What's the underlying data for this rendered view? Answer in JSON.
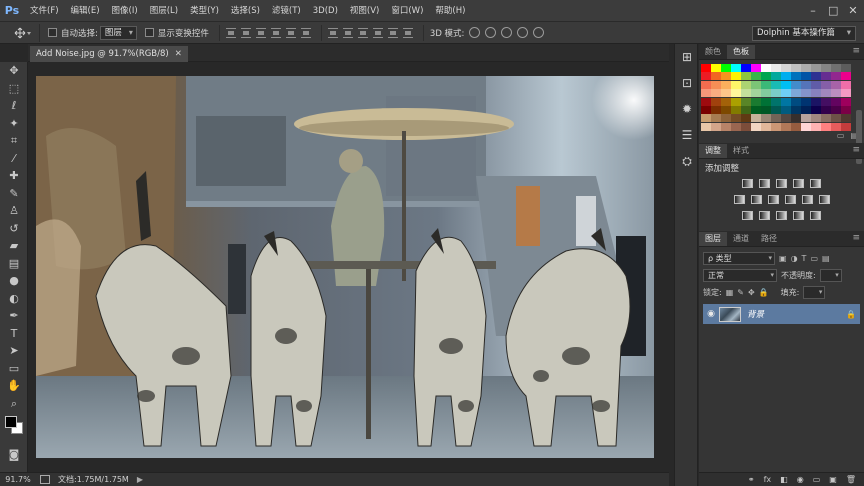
{
  "app": {
    "logo": "Ps"
  },
  "menu": [
    {
      "id": "file",
      "label": "文件(F)"
    },
    {
      "id": "edit",
      "label": "编辑(E)"
    },
    {
      "id": "image",
      "label": "图像(I)"
    },
    {
      "id": "layer",
      "label": "图层(L)"
    },
    {
      "id": "type",
      "label": "类型(Y)"
    },
    {
      "id": "select",
      "label": "选择(S)"
    },
    {
      "id": "filter",
      "label": "滤镜(T)"
    },
    {
      "id": "3d",
      "label": "3D(D)"
    },
    {
      "id": "view",
      "label": "视图(V)"
    },
    {
      "id": "window",
      "label": "窗口(W)"
    },
    {
      "id": "help",
      "label": "帮助(H)"
    }
  ],
  "window_controls": {
    "minimize": "–",
    "maximize": "□",
    "close": "✕"
  },
  "options": {
    "auto_select_label": "自动选择:",
    "auto_select_value": "图层",
    "show_transform_label": "显示变换控件",
    "mode_3d_label": "3D 模式:",
    "workspace": "Dolphin 基本操作篇"
  },
  "document": {
    "tab_title": "Add Noise.jpg @ 91.7%(RGB/8)",
    "close_glyph": "✕"
  },
  "status": {
    "zoom": "91.7%",
    "doc_info": "文档:1.75M/1.75M",
    "arrow": "▶"
  },
  "tools": [
    {
      "name": "move-tool-icon",
      "glyph": "✥"
    },
    {
      "name": "marquee-tool-icon",
      "glyph": "⬚"
    },
    {
      "name": "lasso-tool-icon",
      "glyph": "ℓ"
    },
    {
      "name": "magic-wand-icon",
      "glyph": "✦"
    },
    {
      "name": "crop-tool-icon",
      "glyph": "⌗"
    },
    {
      "name": "eyedropper-icon",
      "glyph": "⁄"
    },
    {
      "name": "healing-brush-icon",
      "glyph": "✚"
    },
    {
      "name": "brush-tool-icon",
      "glyph": "✎"
    },
    {
      "name": "clone-stamp-icon",
      "glyph": "♙"
    },
    {
      "name": "history-brush-icon",
      "glyph": "↺"
    },
    {
      "name": "eraser-tool-icon",
      "glyph": "▰"
    },
    {
      "name": "gradient-tool-icon",
      "glyph": "▤"
    },
    {
      "name": "blur-tool-icon",
      "glyph": "●"
    },
    {
      "name": "dodge-tool-icon",
      "glyph": "◐"
    },
    {
      "name": "pen-tool-icon",
      "glyph": "✒"
    },
    {
      "name": "type-tool-icon",
      "glyph": "T"
    },
    {
      "name": "path-select-icon",
      "glyph": "➤"
    },
    {
      "name": "shape-tool-icon",
      "glyph": "▭"
    },
    {
      "name": "hand-tool-icon",
      "glyph": "✋"
    },
    {
      "name": "zoom-tool-icon",
      "glyph": "⌕"
    }
  ],
  "panels": {
    "color_tabs": {
      "color": "颜色",
      "swatches": "色板"
    },
    "adjust_tabs": {
      "adjustments": "调整",
      "styles": "样式"
    },
    "adjust_title": "添加调整",
    "layer_tabs": {
      "layers": "图层",
      "channels": "通道",
      "paths": "路径"
    },
    "layer_kind": "ρ 类型",
    "blend_mode": "正常",
    "opacity_label": "不透明度:",
    "lock_label": "锁定:",
    "fill_label": "填充:",
    "layer_name": "背景",
    "footer_icons": [
      "⚭",
      "fx",
      "◧",
      "◉",
      "▭",
      "▣",
      "🗑"
    ]
  },
  "swatch_colors": [
    [
      "#ff0000",
      "#ffff00",
      "#00ff00",
      "#00ffff",
      "#0000ff",
      "#ff00ff",
      "#ffffff",
      "#ebebeb",
      "#d6d6d6",
      "#c2c2c2",
      "#adadad",
      "#999999",
      "#858585",
      "#707070",
      "#5c5c5c"
    ],
    [
      "#ed1c24",
      "#f26522",
      "#f7941d",
      "#fff200",
      "#8dc63f",
      "#39b54a",
      "#00a651",
      "#00a99d",
      "#00aeef",
      "#0072bc",
      "#0054a6",
      "#2e3192",
      "#662d91",
      "#92278f",
      "#ec008c"
    ],
    [
      "#f26c4f",
      "#f68e56",
      "#fbaf5d",
      "#fff568",
      "#acd372",
      "#7cc576",
      "#3bb878",
      "#1abbb4",
      "#00bff3",
      "#438ccb",
      "#5574b9",
      "#605ca8",
      "#855fa8",
      "#a763a8",
      "#f06ea9"
    ],
    [
      "#f7977a",
      "#f9ad81",
      "#fdc68a",
      "#fff79a",
      "#c4df9b",
      "#a3d39c",
      "#82ca9d",
      "#7bcdc8",
      "#6ecff6",
      "#7ea7d8",
      "#8493ca",
      "#8882be",
      "#a187be",
      "#bc8dbf",
      "#f49ac2"
    ],
    [
      "#9e0b0f",
      "#a0410d",
      "#a36209",
      "#aba000",
      "#598527",
      "#1a7b30",
      "#007236",
      "#00746b",
      "#0076a3",
      "#004b80",
      "#003471",
      "#1b1464",
      "#440e62",
      "#630460",
      "#9e005d"
    ],
    [
      "#790000",
      "#7b2e00",
      "#7d4900",
      "#827b00",
      "#406618",
      "#005e20",
      "#005826",
      "#005952",
      "#005b7f",
      "#003663",
      "#002157",
      "#0d004c",
      "#32004b",
      "#4b0049",
      "#7b0046"
    ],
    [
      "#c69c6d",
      "#a67c52",
      "#8c6239",
      "#754c24",
      "#603913",
      "#c7b299",
      "#998675",
      "#736357",
      "#534741",
      "#362f2d",
      "#b7a39d",
      "#a08880",
      "#886d62",
      "#6d5247",
      "#4f3930"
    ],
    [
      "#e8c7a8",
      "#d3a58a",
      "#b88368",
      "#9a6650",
      "#7c4d3a",
      "#f2d6c2",
      "#e1b79a",
      "#cc9775",
      "#b17858",
      "#965c3f",
      "#ffd6d6",
      "#ffb3b3",
      "#ff8080",
      "#e65c5c",
      "#c43c3c"
    ]
  ]
}
